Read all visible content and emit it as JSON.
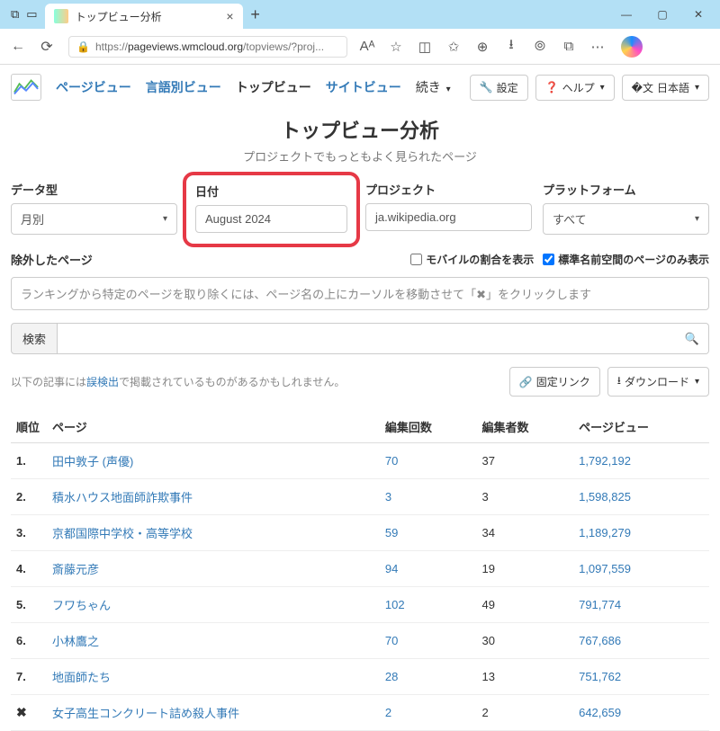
{
  "browser": {
    "tab_title": "トップビュー分析",
    "url_prefix": "https://",
    "url_host": "pageviews.wmcloud.org",
    "url_path": "/topviews/?proj..."
  },
  "nav": {
    "pageviews": "ページビュー",
    "langviews": "言語別ビュー",
    "topviews": "トップビュー",
    "siteviews": "サイトビュー",
    "continue": "続き",
    "settings": "設定",
    "help": "ヘルプ",
    "lang": "日本語"
  },
  "heading": {
    "title": "トップビュー分析",
    "subtitle": "プロジェクトでもっともよく見られたページ"
  },
  "controls": {
    "datatype_label": "データ型",
    "datatype_value": "月別",
    "date_label": "日付",
    "date_value": "August 2024",
    "project_label": "プロジェクト",
    "project_value": "ja.wikipedia.org",
    "platform_label": "プラットフォーム",
    "platform_value": "すべて"
  },
  "row2": {
    "excluded_label": "除外したページ",
    "mobile_label": "モバイルの割合を表示",
    "mainspace_label": "標準名前空間のページのみ表示",
    "exclude_placeholder": "ランキングから特定のページを取り除くには、ページ名の上にカーソルを移動させて「✖」をクリックします"
  },
  "search_label": "検索",
  "note_prefix": "以下の記事には",
  "note_link": "誤検出",
  "note_suffix": "で掲載されているものがあるかもしれません。",
  "permalink": "固定リンク",
  "download": "ダウンロード",
  "table": {
    "h_rank": "順位",
    "h_page": "ページ",
    "h_edits": "編集回数",
    "h_editors": "編集者数",
    "h_views": "ページビュー",
    "rows": [
      {
        "rank": "1.",
        "page": "田中敦子 (声優)",
        "edits": "70",
        "editors": "37",
        "views": "1,792,192"
      },
      {
        "rank": "2.",
        "page": "積水ハウス地面師詐欺事件",
        "edits": "3",
        "editors": "3",
        "views": "1,598,825"
      },
      {
        "rank": "3.",
        "page": "京都国際中学校・高等学校",
        "edits": "59",
        "editors": "34",
        "views": "1,189,279"
      },
      {
        "rank": "4.",
        "page": "斎藤元彦",
        "edits": "94",
        "editors": "19",
        "views": "1,097,559"
      },
      {
        "rank": "5.",
        "page": "フワちゃん",
        "edits": "102",
        "editors": "49",
        "views": "791,774"
      },
      {
        "rank": "6.",
        "page": "小林鷹之",
        "edits": "70",
        "editors": "30",
        "views": "767,686"
      },
      {
        "rank": "7.",
        "page": "地面師たち",
        "edits": "28",
        "editors": "13",
        "views": "751,762"
      },
      {
        "rank": "✖",
        "page": "女子高生コンクリート詰め殺人事件",
        "edits": "2",
        "editors": "2",
        "views": "642,659"
      }
    ]
  }
}
